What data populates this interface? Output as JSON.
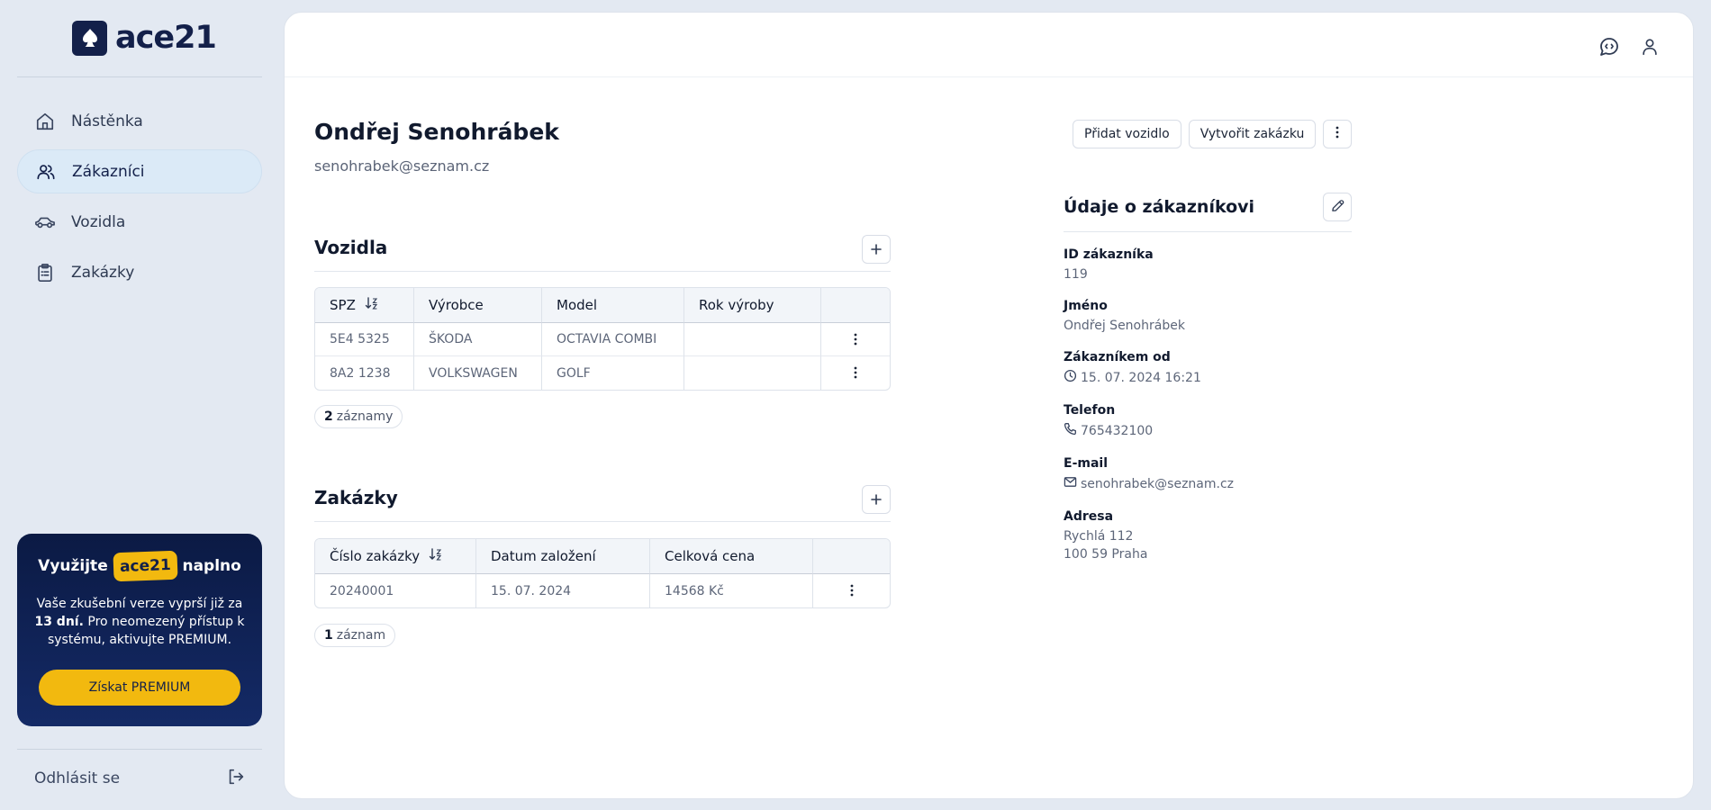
{
  "brand": {
    "name": "ace21"
  },
  "sidebar": {
    "items": [
      {
        "label": "Nástěnka",
        "icon": "home-icon"
      },
      {
        "label": "Zákazníci",
        "icon": "users-icon",
        "active": true
      },
      {
        "label": "Vozidla",
        "icon": "car-icon"
      },
      {
        "label": "Zakázky",
        "icon": "clipboard-icon"
      }
    ],
    "promo": {
      "title_before": "Využijte",
      "title_brand": "ace21",
      "title_after": "naplno",
      "text_before": "Vaše zkušební verze vyprší již za",
      "text_bold": "13 dní.",
      "text_after": "Pro neomezený přístup k systému, aktivujte PREMIUM.",
      "button": "Získat PREMIUM"
    },
    "logout": "Odhlásit se"
  },
  "customer": {
    "name": "Ondřej Senohrábek",
    "email": "senohrabek@seznam.cz"
  },
  "actions": {
    "add_vehicle": "Přidat vozidlo",
    "create_order": "Vytvořit zakázku"
  },
  "vehicles": {
    "title": "Vozidla",
    "columns": [
      "SPZ",
      "Výrobce",
      "Model",
      "Rok výroby"
    ],
    "rows": [
      [
        "5E4 5325",
        "ŠKODA",
        "OCTAVIA COMBI",
        ""
      ],
      [
        "8A2 1238",
        "VOLKSWAGEN",
        "GOLF",
        ""
      ]
    ],
    "count_num": "2",
    "count_word": "záznamy"
  },
  "orders": {
    "title": "Zakázky",
    "columns": [
      "Číslo zakázky",
      "Datum založení",
      "Celková cena"
    ],
    "rows": [
      [
        "20240001",
        "15. 07. 2024",
        "14568 Kč"
      ]
    ],
    "count_num": "1",
    "count_word": "záznam"
  },
  "detail": {
    "title": "Údaje o zákazníkovi",
    "fields": [
      {
        "label": "ID zákazníka",
        "value": "119"
      },
      {
        "label": "Jméno",
        "value": "Ondřej Senohrábek"
      },
      {
        "label": "Zákazníkem od",
        "value": "15. 07. 2024 16:21"
      },
      {
        "label": "Telefon",
        "value": "765432100"
      },
      {
        "label": "E-mail",
        "value": "senohrabek@seznam.cz"
      },
      {
        "label": "Adresa",
        "value_line1": "Rychlá 112",
        "value_line2": "100 59 Praha"
      }
    ]
  }
}
